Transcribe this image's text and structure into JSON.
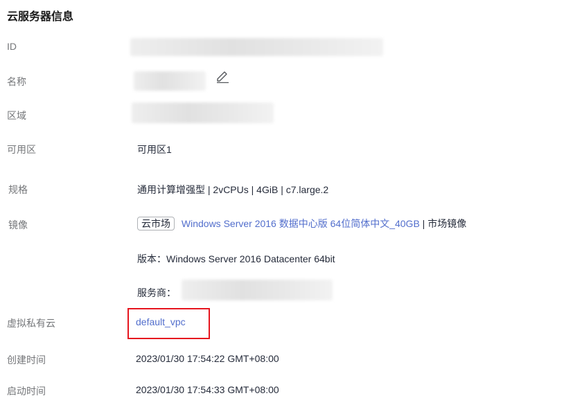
{
  "section": {
    "title": "云服务器信息"
  },
  "labels": {
    "id": "ID",
    "name": "名称",
    "region": "区域",
    "az": "可用区",
    "spec": "规格",
    "image": "镜像",
    "vpc": "虚拟私有云",
    "created": "创建时间",
    "started": "启动时间"
  },
  "values": {
    "az": "可用区1",
    "spec": "通用计算增强型 | 2vCPUs | 4GiB | c7.large.2",
    "image_tag": "云市场",
    "image_name": "Windows Server 2016 数据中心版 64位简体中文_40GB",
    "image_sep": " | ",
    "image_type": "市场镜像",
    "version": "版本：Windows Server 2016 Datacenter 64bit",
    "provider_prefix": "服务商：",
    "vpc": "default_vpc",
    "created": "2023/01/30 17:54:22 GMT+08:00",
    "started": "2023/01/30 17:54:33 GMT+08:00"
  },
  "icons": {
    "edit": "edit-pencil-icon"
  },
  "colors": {
    "link": "#526ecc",
    "highlight_box": "#e6151e",
    "label": "#75777a"
  }
}
